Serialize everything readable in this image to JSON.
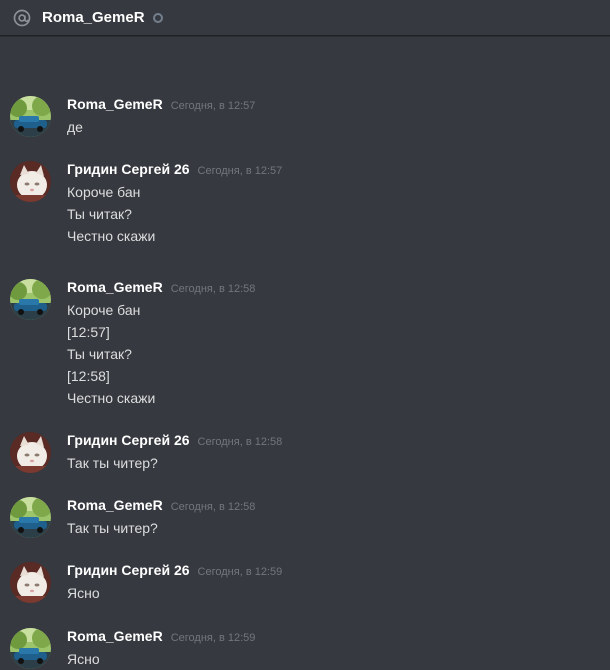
{
  "header": {
    "title": "Roma_GemeR"
  },
  "messages": [
    {
      "author": "Roma_GemeR",
      "timestamp": "Сегодня, в 12:57",
      "avatar": "roma",
      "lines": [
        "де"
      ]
    },
    {
      "author": "Гридин Сергей 26",
      "timestamp": "Сегодня, в 12:57",
      "avatar": "cat",
      "lines": [
        "Короче бан",
        "Ты читак?",
        "Честно скажи"
      ]
    },
    {
      "author": "Roma_GemeR",
      "timestamp": "Сегодня, в 12:58",
      "avatar": "roma",
      "lines": [
        "Короче бан",
        "[12:57]",
        "Ты читак?",
        "[12:58]",
        "Честно скажи"
      ]
    },
    {
      "author": "Гридин Сергей 26",
      "timestamp": "Сегодня, в 12:58",
      "avatar": "cat",
      "lines": [
        "Так ты читер?"
      ]
    },
    {
      "author": "Roma_GemeR",
      "timestamp": "Сегодня, в 12:58",
      "avatar": "roma",
      "lines": [
        "Так ты читер?"
      ]
    },
    {
      "author": "Гридин Сергей 26",
      "timestamp": "Сегодня, в 12:59",
      "avatar": "cat",
      "lines": [
        "Ясно"
      ]
    },
    {
      "author": "Roma_GemeR",
      "timestamp": "Сегодня, в 12:59",
      "avatar": "roma",
      "lines": [
        "Ясно"
      ]
    }
  ],
  "colors": {
    "background": "#36393f",
    "author": "#ffffff",
    "timestamp": "#72767d",
    "text": "#dcddde"
  }
}
